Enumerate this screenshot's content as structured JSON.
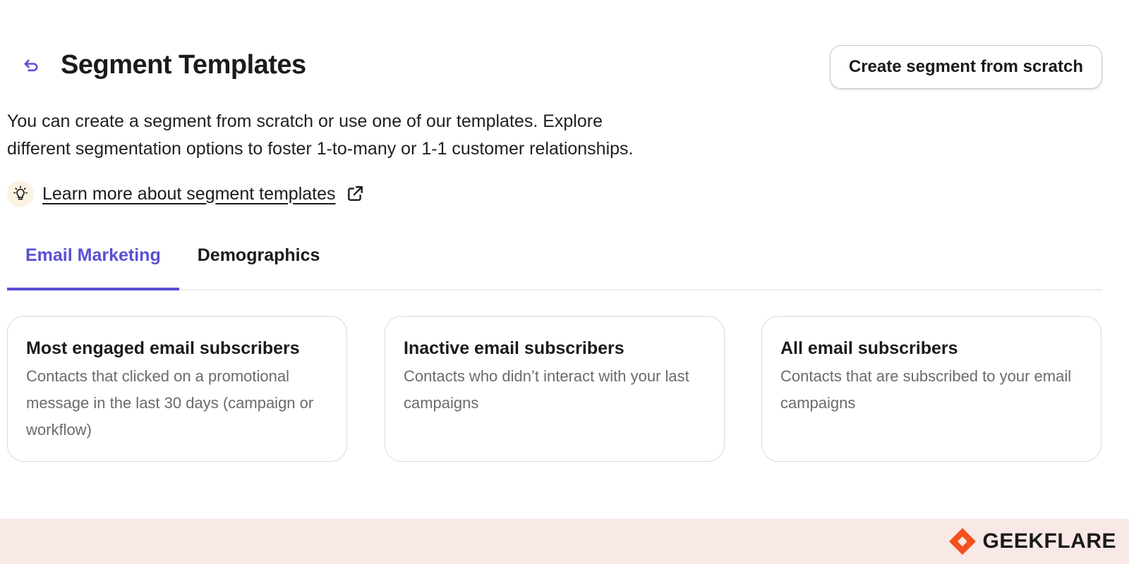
{
  "header": {
    "title": "Segment Templates",
    "create_button_label": "Create segment from scratch"
  },
  "description": {
    "line1": "You can create a segment from scratch or use one of our templates. Explore",
    "line2": "different segmentation options to foster 1-to-many or 1-1 customer relationships."
  },
  "learn_more": {
    "label": "Learn more about segment templates"
  },
  "tabs": [
    {
      "label": "Email Marketing",
      "active": true
    },
    {
      "label": "Demographics",
      "active": false
    }
  ],
  "cards": [
    {
      "title": "Most engaged email subscribers",
      "description": "Contacts that clicked on a promotional message in the last 30 days (campaign or workflow)"
    },
    {
      "title": "Inactive email subscribers",
      "description": "Contacts who didn’t interact with your last campaigns"
    },
    {
      "title": "All email subscribers",
      "description": "Contacts that are subscribed to your email campaigns"
    }
  ],
  "footer": {
    "brand": "GEEKFLARE"
  },
  "colors": {
    "accent": "#5a4fd6",
    "footer_bg": "#f9e9e6",
    "brand_orange": "#f4511e",
    "bulb_bg": "#fbf3e2"
  },
  "icons": {
    "back": "back-arrow-icon",
    "bulb": "lightbulb-icon",
    "external": "external-link-icon",
    "brand": "geekflare-logo-icon"
  }
}
